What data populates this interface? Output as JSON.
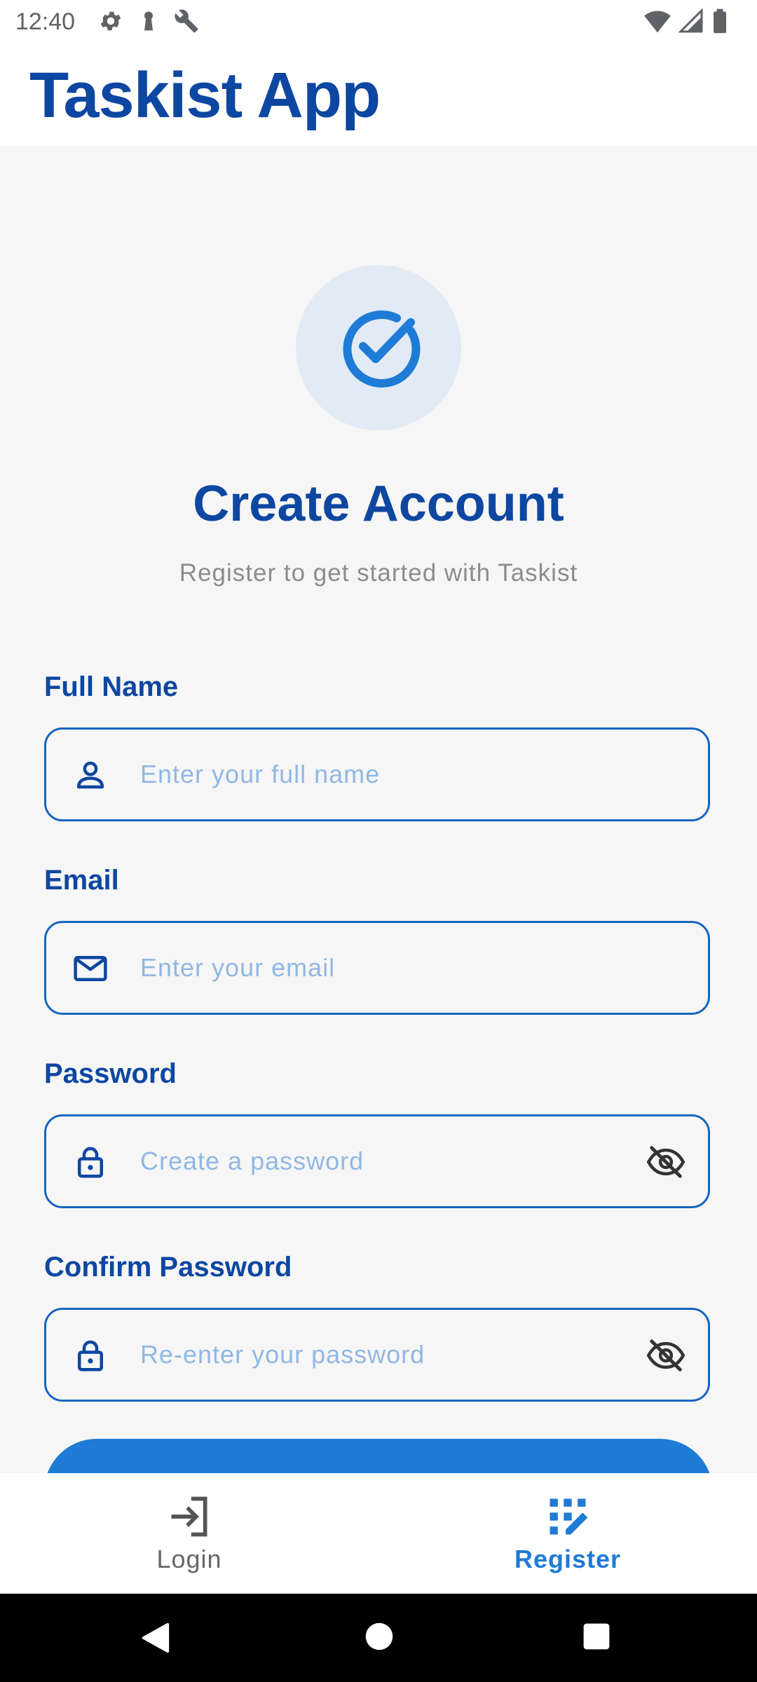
{
  "status_bar": {
    "time": "12:40",
    "left_icons": [
      "settings-icon",
      "keyhole-icon",
      "wrench-icon"
    ],
    "right_icons": [
      "wifi-icon",
      "signal-icon",
      "battery-icon"
    ]
  },
  "app_bar": {
    "title": "Taskist App"
  },
  "header": {
    "logo_icon": "check-circle-icon",
    "title": "Create Account",
    "subtitle": "Register to get started with Taskist"
  },
  "form": {
    "full_name": {
      "label": "Full Name",
      "placeholder": "Enter your full name",
      "value": "",
      "icon": "person-icon"
    },
    "email": {
      "label": "Email",
      "placeholder": "Enter your email",
      "value": "",
      "icon": "mail-icon"
    },
    "password": {
      "label": "Password",
      "placeholder": "Create a password",
      "value": "",
      "icon": "lock-icon",
      "toggle_icon": "visibility-off-icon"
    },
    "confirm_password": {
      "label": "Confirm Password",
      "placeholder": "Re-enter your password",
      "value": "",
      "icon": "lock-icon",
      "toggle_icon": "visibility-off-icon"
    }
  },
  "bottom_nav": {
    "items": [
      {
        "label": "Login",
        "icon": "login-icon",
        "selected": false
      },
      {
        "label": "Register",
        "icon": "app-registration-icon",
        "selected": true
      }
    ]
  },
  "colors": {
    "primary_dark": "#0d47a1",
    "primary": "#1e7bd6",
    "placeholder": "#90b8e3",
    "logo_bg": "#e1eaf5",
    "background": "#f6f6f6"
  }
}
